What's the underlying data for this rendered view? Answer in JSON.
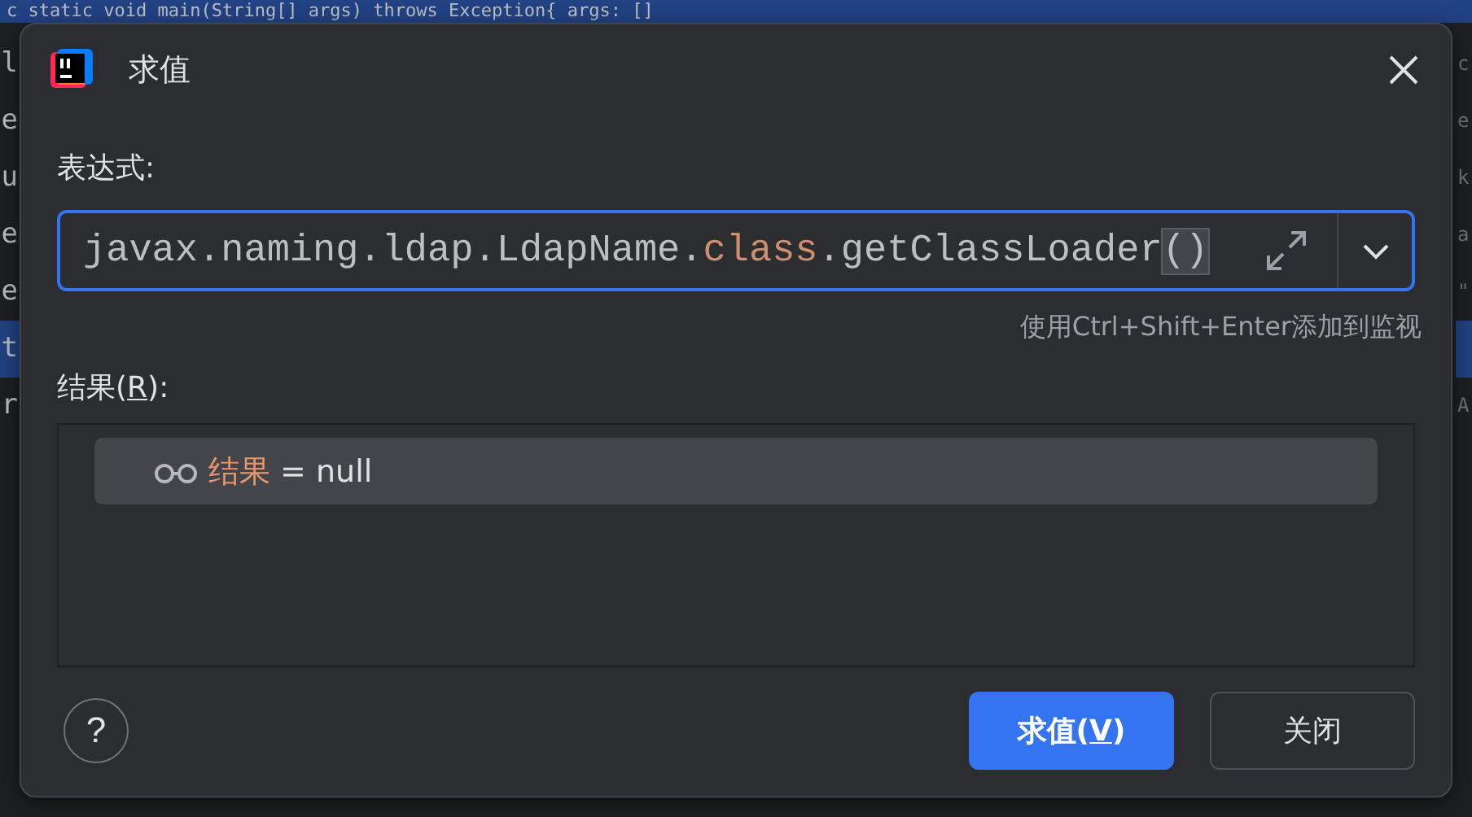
{
  "editor": {
    "top_line": "c static void main(String[] args) throws Exception{   args: []",
    "left_lines": [
      {
        "text": "l",
        "selected": false
      },
      {
        "text": "e",
        "selected": false
      },
      {
        "text": "u",
        "selected": false
      },
      {
        "text": "e",
        "selected": false
      },
      {
        "text": "e",
        "selected": false
      },
      {
        "text": "t",
        "selected": true
      },
      {
        "text": "r",
        "selected": false
      }
    ],
    "right_lines": [
      {
        "text": "c",
        "selected": false
      },
      {
        "text": "e",
        "selected": false
      },
      {
        "text": "k",
        "selected": false
      },
      {
        "text": "a",
        "selected": false
      },
      {
        "text": "\"",
        "selected": false
      },
      {
        "selected": true
      },
      {
        "text": "A",
        "selected": false
      }
    ]
  },
  "dialog": {
    "title": "求值",
    "expression": {
      "label": "表达式:",
      "segments": [
        {
          "kind": "plain",
          "text": "javax.naming.ldap.LdapName."
        },
        {
          "kind": "keyword",
          "text": "class"
        },
        {
          "kind": "plain",
          "text": ".getClassLoader"
        },
        {
          "kind": "bracket",
          "text": "()"
        }
      ]
    },
    "hint": "使用Ctrl+Shift+Enter添加到监视",
    "result": {
      "label_before": "结果(",
      "mnemonic": "R",
      "label_after": "):",
      "rows": [
        {
          "name": "结果",
          "value": " = null",
          "selected": true
        }
      ]
    },
    "buttons": [
      {
        "kind": "primary",
        "before": "求值(",
        "mnemonic": "V",
        "after": ")"
      },
      {
        "kind": "secondary",
        "before": "关闭"
      }
    ],
    "help": "?"
  }
}
